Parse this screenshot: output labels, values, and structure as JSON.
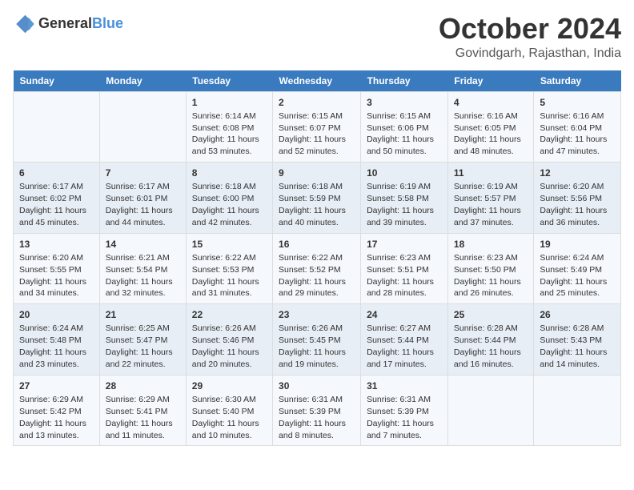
{
  "logo": {
    "general": "General",
    "blue": "Blue"
  },
  "header": {
    "month": "October 2024",
    "location": "Govindgarh, Rajasthan, India"
  },
  "days_of_week": [
    "Sunday",
    "Monday",
    "Tuesday",
    "Wednesday",
    "Thursday",
    "Friday",
    "Saturday"
  ],
  "weeks": [
    [
      {
        "day": "",
        "sunrise": "",
        "sunset": "",
        "daylight": ""
      },
      {
        "day": "",
        "sunrise": "",
        "sunset": "",
        "daylight": ""
      },
      {
        "day": "1",
        "sunrise": "Sunrise: 6:14 AM",
        "sunset": "Sunset: 6:08 PM",
        "daylight": "Daylight: 11 hours and 53 minutes."
      },
      {
        "day": "2",
        "sunrise": "Sunrise: 6:15 AM",
        "sunset": "Sunset: 6:07 PM",
        "daylight": "Daylight: 11 hours and 52 minutes."
      },
      {
        "day": "3",
        "sunrise": "Sunrise: 6:15 AM",
        "sunset": "Sunset: 6:06 PM",
        "daylight": "Daylight: 11 hours and 50 minutes."
      },
      {
        "day": "4",
        "sunrise": "Sunrise: 6:16 AM",
        "sunset": "Sunset: 6:05 PM",
        "daylight": "Daylight: 11 hours and 48 minutes."
      },
      {
        "day": "5",
        "sunrise": "Sunrise: 6:16 AM",
        "sunset": "Sunset: 6:04 PM",
        "daylight": "Daylight: 11 hours and 47 minutes."
      }
    ],
    [
      {
        "day": "6",
        "sunrise": "Sunrise: 6:17 AM",
        "sunset": "Sunset: 6:02 PM",
        "daylight": "Daylight: 11 hours and 45 minutes."
      },
      {
        "day": "7",
        "sunrise": "Sunrise: 6:17 AM",
        "sunset": "Sunset: 6:01 PM",
        "daylight": "Daylight: 11 hours and 44 minutes."
      },
      {
        "day": "8",
        "sunrise": "Sunrise: 6:18 AM",
        "sunset": "Sunset: 6:00 PM",
        "daylight": "Daylight: 11 hours and 42 minutes."
      },
      {
        "day": "9",
        "sunrise": "Sunrise: 6:18 AM",
        "sunset": "Sunset: 5:59 PM",
        "daylight": "Daylight: 11 hours and 40 minutes."
      },
      {
        "day": "10",
        "sunrise": "Sunrise: 6:19 AM",
        "sunset": "Sunset: 5:58 PM",
        "daylight": "Daylight: 11 hours and 39 minutes."
      },
      {
        "day": "11",
        "sunrise": "Sunrise: 6:19 AM",
        "sunset": "Sunset: 5:57 PM",
        "daylight": "Daylight: 11 hours and 37 minutes."
      },
      {
        "day": "12",
        "sunrise": "Sunrise: 6:20 AM",
        "sunset": "Sunset: 5:56 PM",
        "daylight": "Daylight: 11 hours and 36 minutes."
      }
    ],
    [
      {
        "day": "13",
        "sunrise": "Sunrise: 6:20 AM",
        "sunset": "Sunset: 5:55 PM",
        "daylight": "Daylight: 11 hours and 34 minutes."
      },
      {
        "day": "14",
        "sunrise": "Sunrise: 6:21 AM",
        "sunset": "Sunset: 5:54 PM",
        "daylight": "Daylight: 11 hours and 32 minutes."
      },
      {
        "day": "15",
        "sunrise": "Sunrise: 6:22 AM",
        "sunset": "Sunset: 5:53 PM",
        "daylight": "Daylight: 11 hours and 31 minutes."
      },
      {
        "day": "16",
        "sunrise": "Sunrise: 6:22 AM",
        "sunset": "Sunset: 5:52 PM",
        "daylight": "Daylight: 11 hours and 29 minutes."
      },
      {
        "day": "17",
        "sunrise": "Sunrise: 6:23 AM",
        "sunset": "Sunset: 5:51 PM",
        "daylight": "Daylight: 11 hours and 28 minutes."
      },
      {
        "day": "18",
        "sunrise": "Sunrise: 6:23 AM",
        "sunset": "Sunset: 5:50 PM",
        "daylight": "Daylight: 11 hours and 26 minutes."
      },
      {
        "day": "19",
        "sunrise": "Sunrise: 6:24 AM",
        "sunset": "Sunset: 5:49 PM",
        "daylight": "Daylight: 11 hours and 25 minutes."
      }
    ],
    [
      {
        "day": "20",
        "sunrise": "Sunrise: 6:24 AM",
        "sunset": "Sunset: 5:48 PM",
        "daylight": "Daylight: 11 hours and 23 minutes."
      },
      {
        "day": "21",
        "sunrise": "Sunrise: 6:25 AM",
        "sunset": "Sunset: 5:47 PM",
        "daylight": "Daylight: 11 hours and 22 minutes."
      },
      {
        "day": "22",
        "sunrise": "Sunrise: 6:26 AM",
        "sunset": "Sunset: 5:46 PM",
        "daylight": "Daylight: 11 hours and 20 minutes."
      },
      {
        "day": "23",
        "sunrise": "Sunrise: 6:26 AM",
        "sunset": "Sunset: 5:45 PM",
        "daylight": "Daylight: 11 hours and 19 minutes."
      },
      {
        "day": "24",
        "sunrise": "Sunrise: 6:27 AM",
        "sunset": "Sunset: 5:44 PM",
        "daylight": "Daylight: 11 hours and 17 minutes."
      },
      {
        "day": "25",
        "sunrise": "Sunrise: 6:28 AM",
        "sunset": "Sunset: 5:44 PM",
        "daylight": "Daylight: 11 hours and 16 minutes."
      },
      {
        "day": "26",
        "sunrise": "Sunrise: 6:28 AM",
        "sunset": "Sunset: 5:43 PM",
        "daylight": "Daylight: 11 hours and 14 minutes."
      }
    ],
    [
      {
        "day": "27",
        "sunrise": "Sunrise: 6:29 AM",
        "sunset": "Sunset: 5:42 PM",
        "daylight": "Daylight: 11 hours and 13 minutes."
      },
      {
        "day": "28",
        "sunrise": "Sunrise: 6:29 AM",
        "sunset": "Sunset: 5:41 PM",
        "daylight": "Daylight: 11 hours and 11 minutes."
      },
      {
        "day": "29",
        "sunrise": "Sunrise: 6:30 AM",
        "sunset": "Sunset: 5:40 PM",
        "daylight": "Daylight: 11 hours and 10 minutes."
      },
      {
        "day": "30",
        "sunrise": "Sunrise: 6:31 AM",
        "sunset": "Sunset: 5:39 PM",
        "daylight": "Daylight: 11 hours and 8 minutes."
      },
      {
        "day": "31",
        "sunrise": "Sunrise: 6:31 AM",
        "sunset": "Sunset: 5:39 PM",
        "daylight": "Daylight: 11 hours and 7 minutes."
      },
      {
        "day": "",
        "sunrise": "",
        "sunset": "",
        "daylight": ""
      },
      {
        "day": "",
        "sunrise": "",
        "sunset": "",
        "daylight": ""
      }
    ]
  ]
}
